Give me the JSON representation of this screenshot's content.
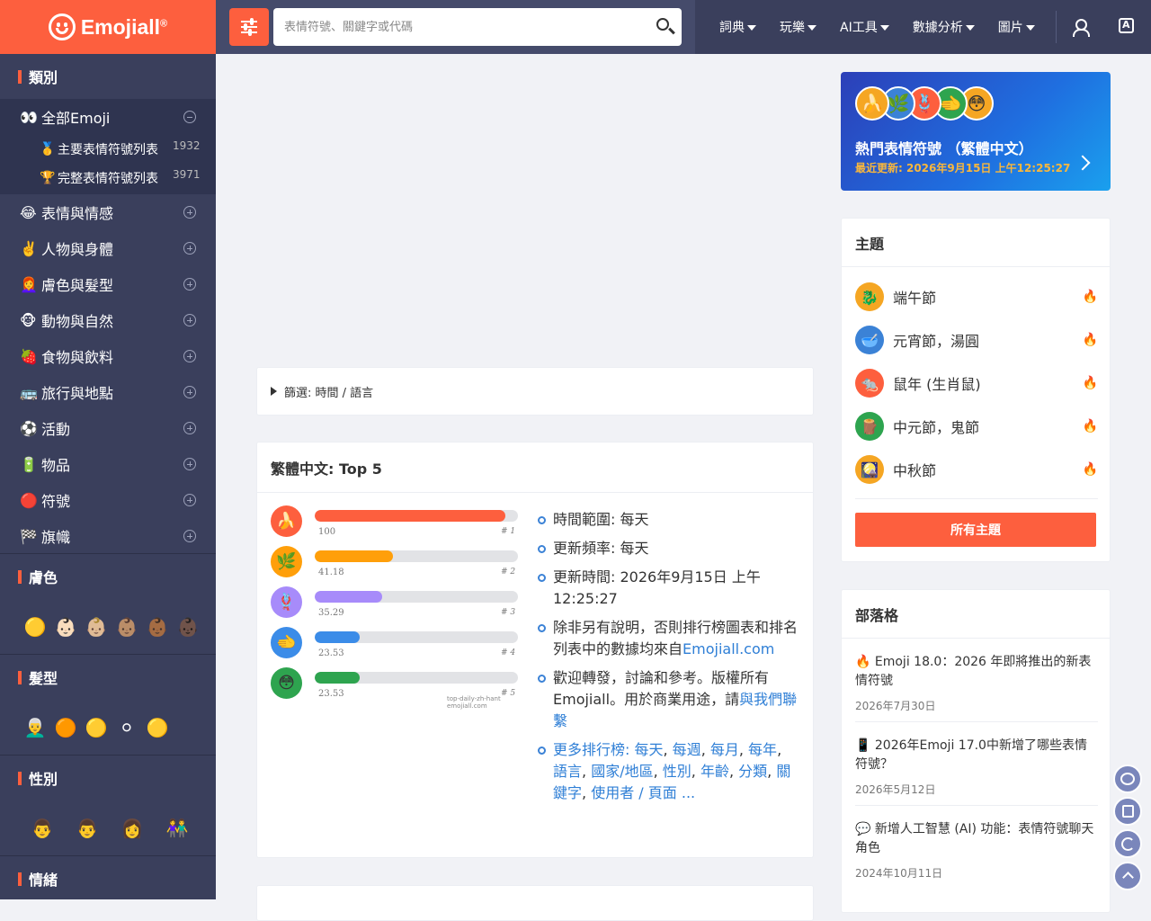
{
  "header": {
    "logo_text": "Emojiall",
    "logo_reg": "®",
    "search_placeholder": "表情符號、關鍵字或代碼",
    "nav": [
      "詞典",
      "玩樂",
      "AI工具",
      "數據分析",
      "圖片"
    ]
  },
  "sidebar": {
    "categories_title": "類別",
    "all": {
      "icon": "👀",
      "label": "全部Emoji"
    },
    "subs": [
      {
        "icon": "🥇",
        "label": "主要表情符號列表",
        "count": "1932"
      },
      {
        "icon": "🏆",
        "label": "完整表情符號列表",
        "count": "3971"
      }
    ],
    "categories": [
      {
        "icon": "😂",
        "label": "表情與情感"
      },
      {
        "icon": "✌️",
        "label": "人物與身體"
      },
      {
        "icon": "👩‍🦰",
        "label": "膚色與髮型"
      },
      {
        "icon": "🐵",
        "label": "動物與自然"
      },
      {
        "icon": "🍓",
        "label": "食物與飲料"
      },
      {
        "icon": "🚌",
        "label": "旅行與地點"
      },
      {
        "icon": "⚽",
        "label": "活動"
      },
      {
        "icon": "🔋",
        "label": "物品"
      },
      {
        "icon": "🔴",
        "label": "符號"
      },
      {
        "icon": "🏁",
        "label": "旗幟"
      }
    ],
    "skin_title": "膚色",
    "skin": [
      "🟡",
      "👶🏻",
      "👶🏼",
      "👶🏽",
      "👶🏾",
      "👶🏿"
    ],
    "hair_title": "髮型",
    "hair": [
      "👨‍🦳",
      "🟠",
      "🟡",
      "⚪",
      "🟡"
    ],
    "gender_title": "性別",
    "gender": [
      "👨",
      "👨",
      "👩",
      "👫"
    ],
    "mood_title": "情緒"
  },
  "main": {
    "filter_label": "篩選: 時間 / 語言",
    "top_title": "繁體中文: Top 5",
    "watermark": "top-daily-zh-hant emojiall.com",
    "info": {
      "range": "時間範圍: 每天",
      "freq": "更新頻率: 每天",
      "updated": "更新時間: 2026年9月15日 上午12:25:27",
      "source_text": "除非另有說明，否則排行榜圖表和排名列表中的數據均來自",
      "source_link": "Emojiall.com",
      "welcome_text": "歡迎轉發，討論和參考。版權所有Emojiall。用於商業用途，請",
      "contact_link": "與我們聯繫",
      "more_label": "更多排行榜: ",
      "more_links": [
        "每天",
        "每週",
        "每月",
        "每年",
        "語言",
        "國家/地區",
        "性別",
        "年齡",
        "分類",
        "關鍵字",
        "使用者 / 頁面"
      ],
      "more_tail": " ..."
    }
  },
  "chart_data": {
    "type": "bar",
    "categories": [
      "🍌",
      "🌿",
      "🪢",
      "🫲",
      "😳"
    ],
    "values": [
      100,
      41.18,
      35.29,
      23.53,
      23.53
    ],
    "value_labels": [
      "100",
      "41.18",
      "35.29",
      "23.53",
      "23.53"
    ],
    "ranks": [
      "# 1",
      "# 2",
      "# 3",
      "# 4",
      "# 5"
    ],
    "colors": [
      "#fd5f3e",
      "#ff9f0a",
      "#a78bfa",
      "#3b8ce8",
      "#2ea44f"
    ],
    "ylim": [
      0,
      100
    ]
  },
  "right": {
    "banner_title": "熱門表情符號 （繁體中文）",
    "banner_update": "最近更新: 2026年9月15日 上午12:25:27",
    "banner_emojis": [
      "🍌",
      "🌿",
      "🪢",
      "🫲",
      "😳"
    ],
    "topics_title": "主題",
    "topics": [
      {
        "icon": "🐉",
        "label": "端午節",
        "color": "#f5a623"
      },
      {
        "icon": "🥣",
        "label": "元宵節，湯圓",
        "color": "#3b82d6"
      },
      {
        "icon": "🐀",
        "label": "鼠年 (生肖鼠)",
        "color": "#fd5f3e"
      },
      {
        "icon": "🪵",
        "label": "中元節，鬼節",
        "color": "#2ea44f"
      },
      {
        "icon": "🎑",
        "label": "中秋節",
        "color": "#f5a623"
      }
    ],
    "topic_badge": "🔥",
    "all_topics": "所有主題",
    "blog_title": "部落格",
    "posts": [
      {
        "title": "🔥 Emoji 18.0：2026 年即將推出的新表情符號",
        "date": "2026年7月30日"
      },
      {
        "title": "📱 2026年Emoji 17.0中新增了哪些表情符號？",
        "date": "2026年5月12日"
      },
      {
        "title": "💬 新增人工智慧 (AI) 功能：表情符號聊天角色",
        "date": "2024年10月11日"
      }
    ]
  }
}
